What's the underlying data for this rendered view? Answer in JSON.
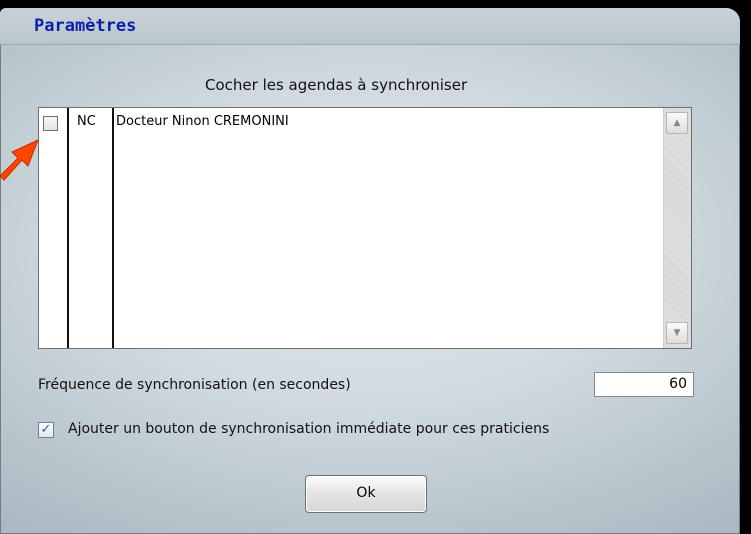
{
  "dialog": {
    "title": "Paramètres",
    "list_caption": "Cocher les agendas à synchroniser",
    "list": {
      "rows": [
        {
          "checked": false,
          "code": "NC",
          "name": "Docteur Ninon CREMONINI"
        }
      ]
    },
    "frequency": {
      "label": "Fréquence de synchronisation (en secondes)",
      "value": "60"
    },
    "immediate_sync": {
      "checked": true,
      "label": "Ajouter un bouton de synchronisation immédiate pour ces praticiens"
    },
    "ok_label": "Ok"
  },
  "colors": {
    "title": "#0b1fa8",
    "annotation_arrow": "#ff4500"
  },
  "icons": {
    "scroll_up": "chevron-up-icon",
    "scroll_down": "chevron-down-icon",
    "annotation": "arrow-icon",
    "check": "checkmark-icon"
  }
}
